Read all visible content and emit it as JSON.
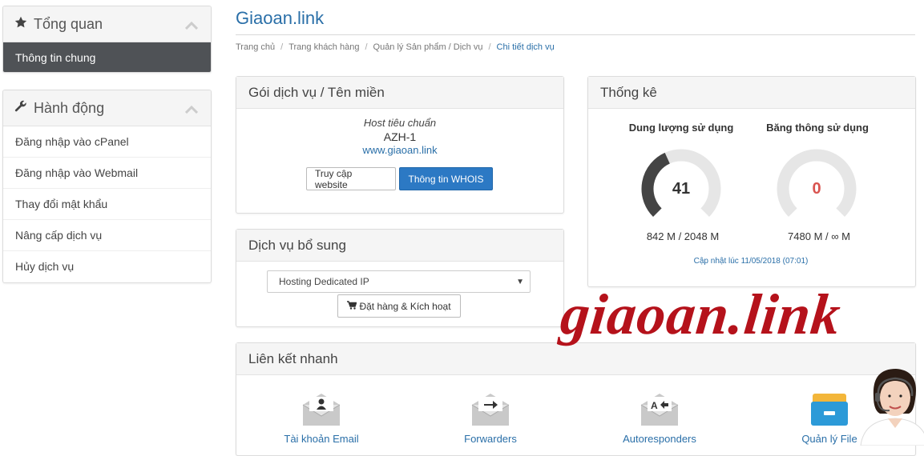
{
  "sidebar": {
    "overview": {
      "title": "Tổng quan",
      "active_item": "Thông tin chung"
    },
    "actions": {
      "title": "Hành động",
      "items": [
        "Đăng nhập vào cPanel",
        "Đăng nhập vào Webmail",
        "Thay đổi mật khẩu",
        "Nâng cấp dịch vụ",
        "Hủy dịch vụ"
      ]
    }
  },
  "header": {
    "title": "Giaoan.link",
    "breadcrumb": [
      "Trang chủ",
      "Trang khách hàng",
      "Quản lý Sản phẩm / Dịch vụ",
      "Chi tiết dịch vụ"
    ]
  },
  "service": {
    "title": "Gói dịch vụ / Tên miền",
    "package_group": "Host tiêu chuẩn",
    "package_name": "AZH-1",
    "domain": "www.giaoan.link",
    "visit_button": "Truy cập website",
    "whois_button": "Thông tin WHOIS"
  },
  "addons": {
    "title": "Dịch vụ bổ sung",
    "selected_option": "Hosting Dedicated IP",
    "order_button": "Đặt hàng & Kích hoạt"
  },
  "stats": {
    "title": "Thống kê",
    "disk": {
      "label": "Dung lượng sử dụng",
      "percent": 41,
      "value": "842 M / 2048 M",
      "color": "#444444"
    },
    "bandwidth": {
      "label": "Băng thông sử dụng",
      "percent": 0,
      "value": "7480 M / ∞ M",
      "color": "#d9534f"
    },
    "updated": "Cập nhật lúc 11/05/2018 (07:01)"
  },
  "quick_links": {
    "title": "Liên kết nhanh",
    "items": [
      {
        "label": "Tài khoản Email",
        "icon": "email-account-icon"
      },
      {
        "label": "Forwarders",
        "icon": "forwarders-icon"
      },
      {
        "label": "Autoresponders",
        "icon": "autoresponders-icon"
      },
      {
        "label": "Quản lý File",
        "icon": "file-manager-icon"
      }
    ]
  },
  "watermark": "giaoan.link",
  "colors": {
    "accent": "#2a6fa8",
    "primary_button": "#2c79c4",
    "active_nav": "#4f5256",
    "watermark": "#b5121b"
  }
}
